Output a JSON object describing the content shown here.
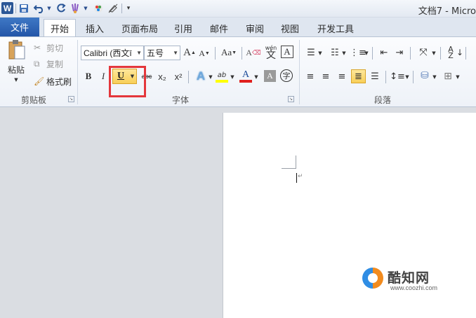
{
  "titlebar": {
    "title": "文档7 - Micro",
    "qat": {
      "logo_letter": "W",
      "save_icon": "save-icon",
      "undo_icon": "undo-icon",
      "redo_icon": "redo-icon",
      "format_painter_icon": "paint-icon",
      "color_icon": "color-wheel-icon",
      "eraser_icon": "eraser-icon",
      "customize_icon": "customize-icon"
    }
  },
  "tabs": {
    "file": "文件",
    "items": [
      "开始",
      "插入",
      "页面布局",
      "引用",
      "邮件",
      "审阅",
      "视图",
      "开发工具"
    ],
    "active": "开始"
  },
  "clipboard": {
    "paste": "粘贴",
    "cut": "剪切",
    "copy": "复制",
    "format_painter": "格式刷",
    "group_label": "剪贴板"
  },
  "font": {
    "font_name": "Calibri (西文ī",
    "font_size": "五号",
    "grow": "A",
    "shrink": "A",
    "change_case": "Aa",
    "clear_format": "A",
    "pinyin": "wén",
    "pinyin_char": "文",
    "char_border": "A",
    "bold": "B",
    "italic": "I",
    "underline": "U",
    "strike": "abc",
    "subscript": "x₂",
    "superscript": "x²",
    "text_effect": "A",
    "highlight": "ab",
    "font_color": "A",
    "char_shading": "A",
    "enclose": "字",
    "group_label": "字体"
  },
  "paragraph": {
    "group_label": "段落"
  },
  "colors": {
    "accent": "#2b579a",
    "highlight_selected": "#f8cf58",
    "annotation_red": "#e4373c",
    "font_color_bar": "#e0201e",
    "highlight_bar": "#ffff00"
  },
  "watermark": {
    "name": "酷知网",
    "url": "www.coozhi.com"
  }
}
